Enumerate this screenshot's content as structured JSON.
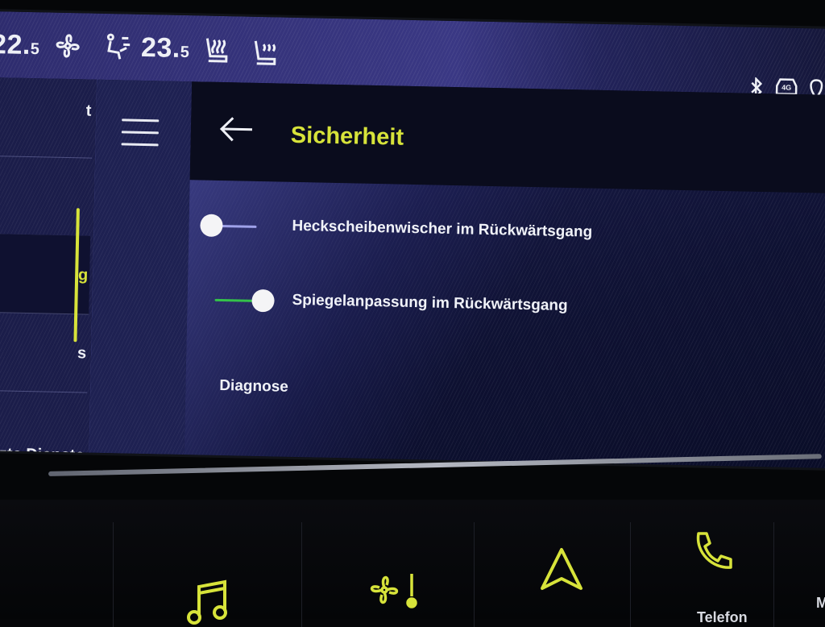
{
  "status": {
    "driver_temp": "22.",
    "driver_temp_decimal": "5",
    "passenger_temp": "23.",
    "passenger_temp_decimal": "5",
    "icons": [
      "fan-icon",
      "air-flow-icon",
      "seat-heat-icon",
      "seat-heat-icon",
      "bluetooth-icon",
      "4g-car-icon",
      "location-icon"
    ],
    "net_badge": "4G"
  },
  "sidebar": {
    "items": [
      {
        "label": "t"
      },
      {
        "label": ""
      },
      {
        "label": "g"
      },
      {
        "label": "s"
      },
      {
        "label": "zte Dienste"
      }
    ]
  },
  "header": {
    "title": "Sicherheit"
  },
  "settings": {
    "rows": [
      {
        "label": "Heckscheibenwischer im Rückwärtsgang",
        "enabled": false
      },
      {
        "label": "Spiegelanpassung im Rückwärtsgang",
        "enabled": true
      }
    ],
    "diagnose_label": "Diagnose"
  },
  "dock": {
    "telefon_label": "Telefon",
    "partial_label": "M"
  },
  "colors": {
    "accent": "#d7e33a",
    "toggle_on": "#34c24a",
    "toggle_off": "#9fa2ea"
  }
}
